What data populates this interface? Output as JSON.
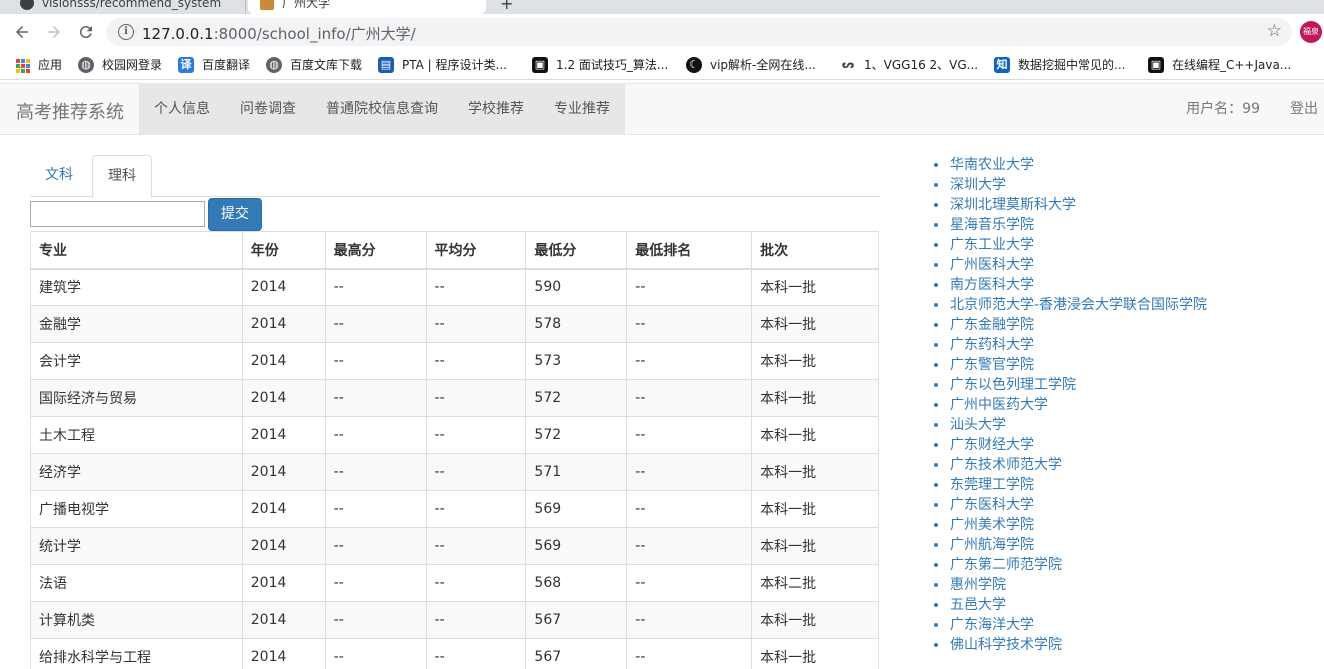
{
  "browser": {
    "tabs": [
      {
        "title": "visionsss/recommend_system"
      },
      {
        "title": "广州大学"
      }
    ],
    "url_host": "127.0.0.1",
    "url_path": ":8000/school_info/广州大学/",
    "profile_label": "福泉",
    "bookmarks": [
      {
        "label": "应用",
        "icon": "apps-grid-icon"
      },
      {
        "label": "校园网登录",
        "icon": "globe-icon"
      },
      {
        "label": "百度翻译",
        "icon": "translate-icon",
        "icon_text": "译",
        "color": "#2c7be5"
      },
      {
        "label": "百度文库下载",
        "icon": "globe-icon"
      },
      {
        "label": "PTA | 程序设计类...",
        "icon": "pta-icon",
        "color": "#1a5fb4"
      },
      {
        "label": "1.2 面试技巧_算法...",
        "icon": "code-icon",
        "color": "#111111"
      },
      {
        "label": "vip解析-全网在线...",
        "icon": "moon-icon",
        "color": "#111111"
      },
      {
        "label": "1、VGG16 2、VG...",
        "icon": "vgg-icon",
        "color": "#444444"
      },
      {
        "label": "数据挖掘中常见的...",
        "icon": "zhihu-icon",
        "icon_text": "知",
        "color": "#0a66c2"
      },
      {
        "label": "在线编程_C++Java...",
        "icon": "code-icon",
        "color": "#111111"
      }
    ]
  },
  "navbar": {
    "brand": "高考推荐系统",
    "items": [
      "个人信息",
      "问卷调查",
      "普通院校信息查询",
      "学校推荐",
      "专业推荐"
    ],
    "username": "用户名：99",
    "logout": "登出"
  },
  "tabs": [
    "文科",
    "理科"
  ],
  "active_tab": "理科",
  "search": {
    "value": "",
    "submit_label": "提交"
  },
  "table": {
    "headers": [
      "专业",
      "年份",
      "最高分",
      "平均分",
      "最低分",
      "最低排名",
      "批次"
    ],
    "rows": [
      [
        "建筑学",
        "2014",
        "--",
        "--",
        "590",
        "--",
        "本科一批"
      ],
      [
        "金融学",
        "2014",
        "--",
        "--",
        "578",
        "--",
        "本科一批"
      ],
      [
        "会计学",
        "2014",
        "--",
        "--",
        "573",
        "--",
        "本科一批"
      ],
      [
        "国际经济与贸易",
        "2014",
        "--",
        "--",
        "572",
        "--",
        "本科一批"
      ],
      [
        "土木工程",
        "2014",
        "--",
        "--",
        "572",
        "--",
        "本科一批"
      ],
      [
        "经济学",
        "2014",
        "--",
        "--",
        "571",
        "--",
        "本科一批"
      ],
      [
        "广播电视学",
        "2014",
        "--",
        "--",
        "569",
        "--",
        "本科一批"
      ],
      [
        "统计学",
        "2014",
        "--",
        "--",
        "569",
        "--",
        "本科一批"
      ],
      [
        "法语",
        "2014",
        "--",
        "--",
        "568",
        "--",
        "本科二批"
      ],
      [
        "计算机类",
        "2014",
        "--",
        "--",
        "567",
        "--",
        "本科一批"
      ],
      [
        "给排水科学与工程",
        "2014",
        "--",
        "--",
        "567",
        "--",
        "本科一批"
      ]
    ]
  },
  "schools": [
    "华南农业大学",
    "深圳大学",
    "深圳北理莫斯科大学",
    "星海音乐学院",
    "广东工业大学",
    "广州医科大学",
    "南方医科大学",
    "北京师范大学-香港浸会大学联合国际学院",
    "广东金融学院",
    "广东药科大学",
    "广东警官学院",
    "广东以色列理工学院",
    "广州中医药大学",
    "汕头大学",
    "广东财经大学",
    "广东技术师范大学",
    "东莞理工学院",
    "广东医科大学",
    "广州美术学院",
    "广州航海学院",
    "广东第二师范学院",
    "惠州学院",
    "五邑大学",
    "广东海洋大学",
    "佛山科学技术学院"
  ],
  "colors": {
    "link": "#337ab7",
    "primary_button": "#337ab7",
    "navbar_bg": "#f8f8f8"
  }
}
